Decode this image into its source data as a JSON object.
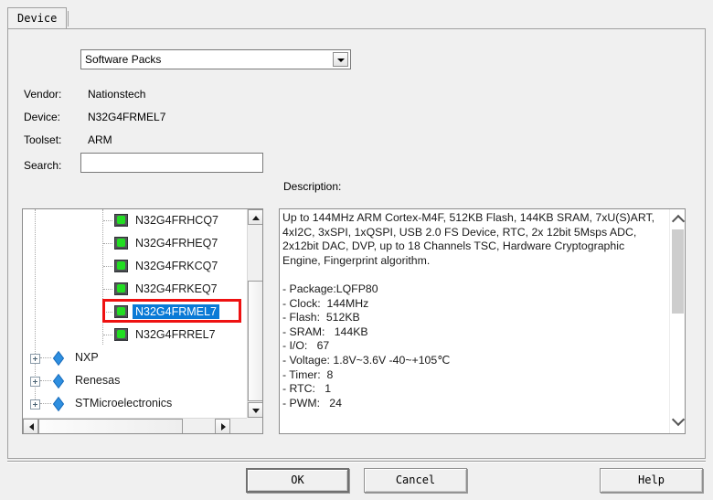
{
  "dialog": {
    "tab_label": "Device"
  },
  "pack_selector": {
    "value": "Software Packs",
    "dropdown_icon": "chevron-down-icon"
  },
  "info": {
    "vendor_label": "Vendor:",
    "vendor_value": "Nationstech",
    "device_label": "Device:",
    "device_value": "N32G4FRMEL7",
    "toolset_label": "Toolset:",
    "toolset_value": "ARM",
    "search_label": "Search:",
    "search_value": "",
    "search_placeholder": ""
  },
  "description": {
    "label": "Description:",
    "text": "Up to 144MHz ARM Cortex-M4F, 512KB Flash, 144KB SRAM, 7xU(S)ART, 4xI2C, 3xSPI, 1xQSPI, USB 2.0 FS Device, RTC, 2x 12bit 5Msps ADC, 2x12bit DAC, DVP, up to 18 Channels TSC, Hardware Cryptographic Engine, Fingerprint algorithm.\n\n- Package:LQFP80\n- Clock:  144MHz\n- Flash:  512KB\n- SRAM:   144KB\n- I/O:   67\n- Voltage: 1.8V~3.6V -40~+105℃\n- Timer:  8\n- RTC:   1\n- PWM:   24"
  },
  "device_tree": {
    "devices": [
      {
        "label": "N32G4FRHCQ7",
        "icon": "chip-icon",
        "selected": false
      },
      {
        "label": "N32G4FRHEQ7",
        "icon": "chip-icon",
        "selected": false
      },
      {
        "label": "N32G4FRKCQ7",
        "icon": "chip-icon",
        "selected": false
      },
      {
        "label": "N32G4FRKEQ7",
        "icon": "chip-icon",
        "selected": false
      },
      {
        "label": "N32G4FRMEL7",
        "icon": "chip-icon",
        "selected": true
      },
      {
        "label": "N32G4FRREL7",
        "icon": "chip-icon",
        "selected": false
      }
    ],
    "vendors": [
      {
        "label": "NXP",
        "icon": "vendor-diamond-icon",
        "expander": "plus-icon"
      },
      {
        "label": "Renesas",
        "icon": "vendor-diamond-icon",
        "expander": "plus-icon"
      },
      {
        "label": "STMicroelectronics",
        "icon": "vendor-diamond-icon",
        "expander": "plus-icon"
      }
    ]
  },
  "footer": {
    "ok_label": "OK",
    "cancel_label": "Cancel",
    "help_label": "Help"
  },
  "colors": {
    "selection_blue": "#0a7ad6",
    "annotation_red": "#ee1111",
    "chip_green": "#22dd22",
    "vendor_blue": "#2e8fe0",
    "dialog_bg": "#f0f0f0"
  }
}
